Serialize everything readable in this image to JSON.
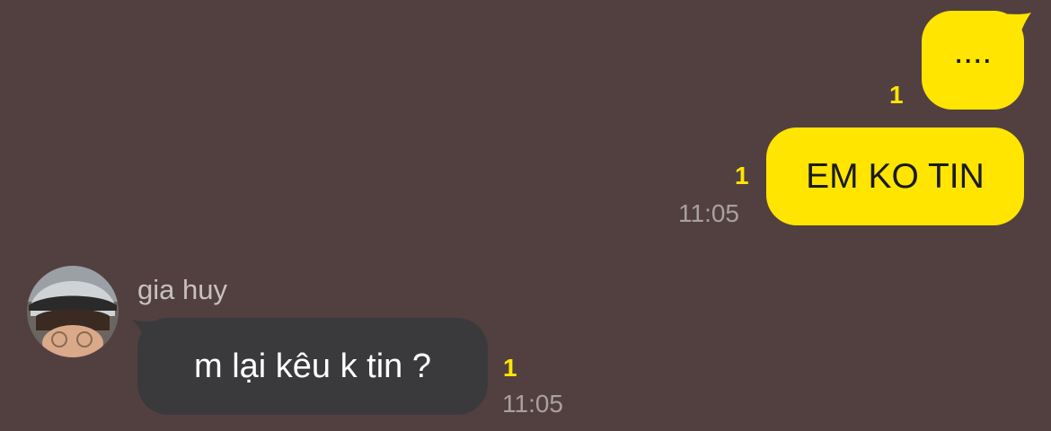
{
  "conversation": {
    "messages": [
      {
        "direction": "outgoing",
        "text": "....",
        "unread_count": "1"
      },
      {
        "direction": "outgoing",
        "text": "EM KO TIN",
        "unread_count": "1",
        "time": "11:05"
      },
      {
        "direction": "incoming",
        "sender": "gia huy",
        "text": "m lại kêu k tin ?",
        "unread_count": "1",
        "time": "11:05"
      }
    ]
  },
  "colors": {
    "background": "#524041",
    "outgoing_bubble": "#ffe500",
    "incoming_bubble": "#3a3a3c",
    "unread_badge": "#ffe500",
    "timestamp": "#a8a0a0"
  },
  "icons": {
    "avatar": "user-avatar-photo"
  }
}
